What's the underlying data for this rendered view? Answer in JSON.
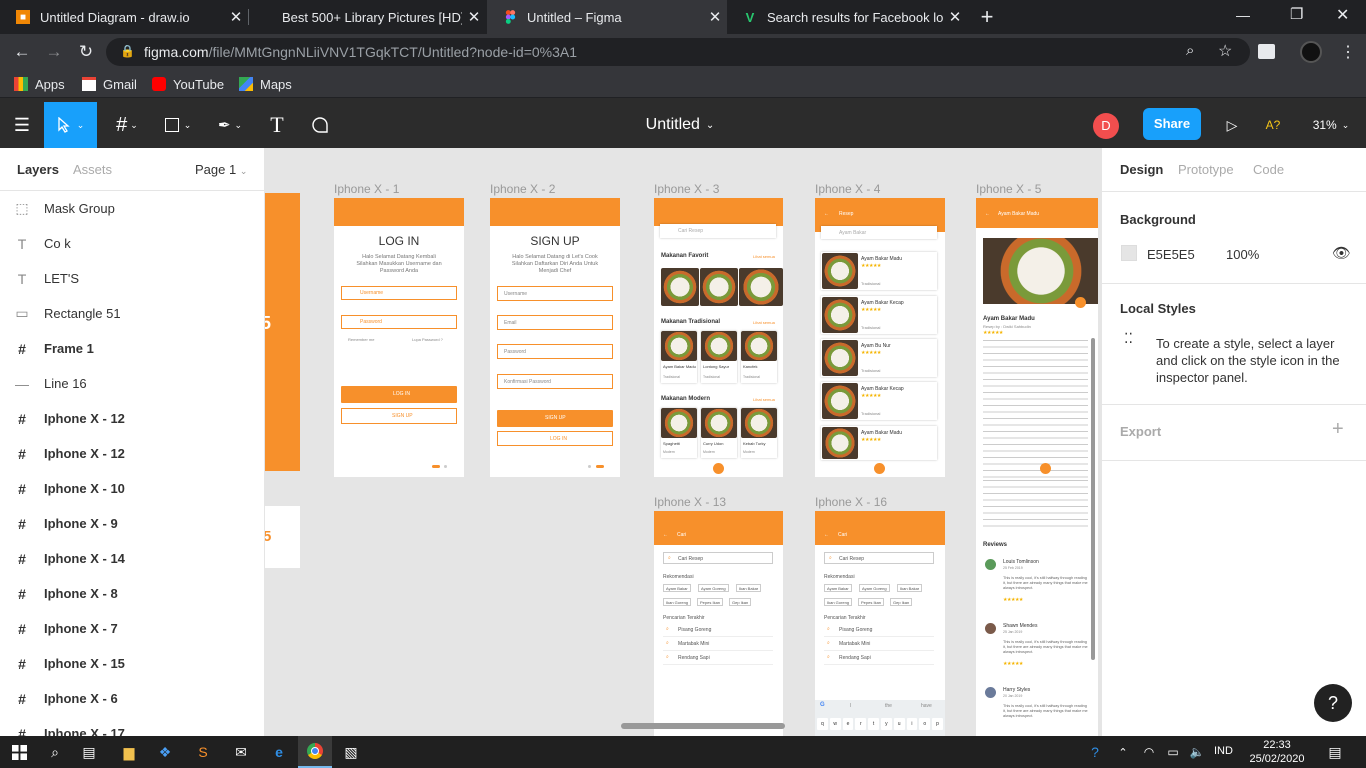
{
  "browser": {
    "tabs": [
      {
        "title": "Untitled Diagram - draw.io",
        "icon": "drawio-icon"
      },
      {
        "title": "Best 500+ Library Pictures [HD] |",
        "icon": "unsplash-icon"
      },
      {
        "title": "Untitled – Figma",
        "icon": "figma-icon",
        "active": true
      },
      {
        "title": "Search results for Facebook logo",
        "icon": "vectorstock-icon"
      }
    ],
    "url_host": "figma.com",
    "url_path": "/file/MMtGngnNLiiVNV1TGqkTCT/Untitled?node-id=0%3A1",
    "bookmarks": [
      "Apps",
      "Gmail",
      "YouTube",
      "Maps"
    ]
  },
  "figma": {
    "file_title": "Untitled",
    "share_label": "Share",
    "avatar_initial": "D",
    "zoom": "31%",
    "help_label": "A?",
    "accent": "#18a0fb"
  },
  "left_panel": {
    "tabs": [
      "Layers",
      "Assets"
    ],
    "page": "Page 1",
    "layers": [
      {
        "name": "Mask Group",
        "icon": "mask-icon",
        "frame": false
      },
      {
        "name": "Co k",
        "icon": "text-icon",
        "frame": false
      },
      {
        "name": "LET'S",
        "icon": "text-icon",
        "frame": false
      },
      {
        "name": "Rectangle 51",
        "icon": "rectangle-icon",
        "frame": false
      },
      {
        "name": "Frame 1",
        "icon": "frame-icon",
        "frame": true
      },
      {
        "name": "Line 16",
        "icon": "line-icon",
        "frame": false
      },
      {
        "name": "Iphone X - 12",
        "icon": "frame-icon",
        "frame": true
      },
      {
        "name": "Iphone X - 12",
        "icon": "frame-icon",
        "frame": true
      },
      {
        "name": "Iphone X - 10",
        "icon": "frame-icon",
        "frame": true
      },
      {
        "name": "Iphone X - 9",
        "icon": "frame-icon",
        "frame": true
      },
      {
        "name": "Iphone X - 14",
        "icon": "frame-icon",
        "frame": true
      },
      {
        "name": "Iphone X - 8",
        "icon": "frame-icon",
        "frame": true
      },
      {
        "name": "Iphone X - 7",
        "icon": "frame-icon",
        "frame": true
      },
      {
        "name": "Iphone X - 15",
        "icon": "frame-icon",
        "frame": true
      },
      {
        "name": "Iphone X - 6",
        "icon": "frame-icon",
        "frame": true
      },
      {
        "name": "Iphone X - 17",
        "icon": "frame-icon",
        "frame": true
      }
    ]
  },
  "right_panel": {
    "tabs": [
      "Design",
      "Prototype",
      "Code"
    ],
    "background_title": "Background",
    "background_hex": "E5E5E5",
    "background_opacity": "100%",
    "local_styles_title": "Local Styles",
    "local_styles_text": "To create a style, select a layer and click on the style icon in the inspector panel.",
    "export_title": "Export"
  },
  "canvas": {
    "frames": [
      "Iphone X - 1",
      "Iphone X -  2",
      "Iphone X - 3",
      "Iphone X - 4",
      "Iphone X - 5",
      "Iphone X - 13",
      "Iphone X - 16"
    ],
    "login": {
      "title": "LOG IN",
      "subtitle": "Halo Selamat Datang Kembali Silahkan Masukkan Username dan Password Anda",
      "username": "Username",
      "password": "Password",
      "remember": "Remember me",
      "forgot": "Lupa Password ?",
      "login_btn": "LOG IN",
      "signup_btn": "SIGN UP"
    },
    "signup": {
      "title": "SIGN UP",
      "subtitle": "Halo Selamat Datang di Let's Cook Silahkan Daftarkan Diri Anda Untuk Menjadi Chef",
      "fields": [
        "Username",
        "Email",
        "Password",
        "Konfirmasi Password"
      ],
      "signup_btn": "SIGN UP",
      "login_btn": "LOG IN"
    },
    "home": {
      "search": "Cari Resep",
      "sections": [
        "Makanan Favorit",
        "Makanan Tradisional",
        "Makanan Modern"
      ],
      "see_all": "Lihat semua",
      "trad_items": [
        "Ayam Bakar Madu",
        "Lontong Sayur",
        "Kancfek"
      ],
      "modern_items": [
        "Spaghetti",
        "Curry Udon",
        "Kebab Turky"
      ],
      "item_sub": "Tradisional",
      "modern_sub": "Modern"
    },
    "resep": {
      "title": "Resep",
      "search": "Ayam Bakar",
      "items": [
        "Ayam Bakar Madu",
        "Ayam Bakar Kecap",
        "Ayam Bu Nur",
        "Ayam Bakar Kecap",
        "Ayam Bakar Madu"
      ],
      "sub": "Tradisional"
    },
    "detail": {
      "header": "Ayam Bakar Madu",
      "title": "Ayam Bakar Madu",
      "author": "Resep by : Dwiki Sahbudin",
      "reviews_title": "Reviews",
      "reviewers": [
        {
          "name": "Louis Tomlinson",
          "date": "25 Feb 2019"
        },
        {
          "name": "Shawn Mendes",
          "date": "25 Jan 2019"
        },
        {
          "name": "Harry Styles",
          "date": "20 Jan 2019"
        }
      ],
      "review_text": "This is really cool, it's still halfway through reading it, but there are already many things that make me always introspect."
    },
    "cari": {
      "title": "Cari",
      "search": "Cari Resep",
      "rekomendasi": "Rekomendasi",
      "tags": [
        "Ayam Bakar",
        "Ayam Goreng",
        "Ikan Bakar",
        "Ikan Goreng",
        "Pepes Ikan",
        "Gep Ikan"
      ],
      "recent_title": "Pencarian Terakhir",
      "recent": [
        "Pisang Goreng",
        "Martabak Mini",
        "Rendang Sapi"
      ]
    },
    "keyboard_row": [
      "q",
      "w",
      "e",
      "r",
      "t",
      "y",
      "u",
      "i",
      "o",
      "p"
    ],
    "keyboard_suggest": [
      "I",
      "the",
      "have"
    ]
  },
  "taskbar": {
    "lang": "IND",
    "time": "22:33",
    "date": "25/02/2020"
  }
}
